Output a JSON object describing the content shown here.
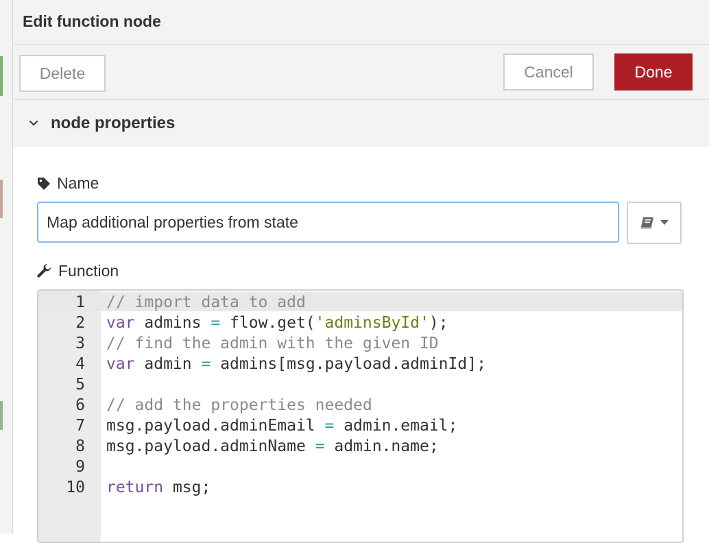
{
  "dialog": {
    "title": "Edit function node",
    "delete_label": "Delete",
    "cancel_label": "Cancel",
    "done_label": "Done",
    "section_label": "node properties"
  },
  "form": {
    "name_label": "Name",
    "name_value": "Map additional properties from state",
    "function_label": "Function"
  },
  "editor": {
    "line_numbers": [
      "1",
      "2",
      "3",
      "4",
      "5",
      "6",
      "7",
      "8",
      "9",
      "10"
    ],
    "lines": [
      [
        {
          "t": "// import data to add",
          "c": "comment"
        }
      ],
      [
        {
          "t": "var",
          "c": "kw"
        },
        {
          "t": " admins ",
          "c": ""
        },
        {
          "t": "=",
          "c": "op"
        },
        {
          "t": " flow.get(",
          "c": ""
        },
        {
          "t": "'adminsById'",
          "c": "str"
        },
        {
          "t": ");",
          "c": ""
        }
      ],
      [
        {
          "t": "// find the admin with the given ID",
          "c": "comment"
        }
      ],
      [
        {
          "t": "var",
          "c": "kw"
        },
        {
          "t": " admin ",
          "c": ""
        },
        {
          "t": "=",
          "c": "op"
        },
        {
          "t": " admins[msg.payload.adminId];",
          "c": ""
        }
      ],
      [],
      [
        {
          "t": "// add the properties needed",
          "c": "comment"
        }
      ],
      [
        {
          "t": "msg.payload.adminEmail ",
          "c": ""
        },
        {
          "t": "=",
          "c": "op"
        },
        {
          "t": " admin.email;",
          "c": ""
        }
      ],
      [
        {
          "t": "msg.payload.adminName ",
          "c": ""
        },
        {
          "t": "=",
          "c": "op"
        },
        {
          "t": " admin.name;",
          "c": ""
        }
      ],
      [],
      [
        {
          "t": "return",
          "c": "kw"
        },
        {
          "t": " msg;",
          "c": ""
        }
      ]
    ]
  },
  "icons": {
    "chevron": "chevron-down-icon",
    "tag": "tag-icon",
    "wrench": "wrench-icon",
    "book": "book-icon",
    "caret": "caret-down-icon"
  },
  "colors": {
    "done_bg": "#ad1f25",
    "input_focus_border": "#85b6ee",
    "keyword": "#7a4b9e",
    "string": "#6b7f15",
    "comment": "#8a8a8a",
    "operator": "#2aa198"
  }
}
